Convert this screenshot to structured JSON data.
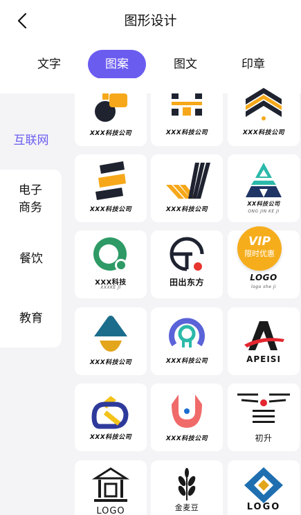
{
  "header": {
    "title": "图形设计"
  },
  "tabs": [
    {
      "label": "文字",
      "active": false
    },
    {
      "label": "图案",
      "active": true
    },
    {
      "label": "图文",
      "active": false
    },
    {
      "label": "印章",
      "active": false
    }
  ],
  "sidebar": {
    "items": [
      {
        "label": "互联网",
        "active": true
      },
      {
        "label": "电子商务",
        "active": false
      },
      {
        "label": "餐饮",
        "active": false
      },
      {
        "label": "教育",
        "active": false
      }
    ]
  },
  "logos": [
    {
      "caption": "XXX科技公司"
    },
    {
      "caption": "XXX科技公司"
    },
    {
      "caption": "XXX科技公司"
    },
    {
      "caption": "XXX科技公司"
    },
    {
      "caption": "XXX科技公司"
    },
    {
      "caption": "XX科技公司",
      "sub": "ONG JIN KE JI"
    },
    {
      "caption": "XXX科技",
      "sub": "XXXKE JI"
    },
    {
      "caption": "田出东方"
    },
    {
      "caption": "LOGO",
      "sub": "logo she ji"
    },
    {
      "caption": "XXX科技公司"
    },
    {
      "caption": "XXX科技公司"
    },
    {
      "caption": "APEISI"
    },
    {
      "caption": "XXX科技公司"
    },
    {
      "caption": "XXX科技公司"
    },
    {
      "caption": "初升"
    },
    {
      "caption": "LOGO"
    },
    {
      "caption": "金麦豆"
    },
    {
      "caption": "LOGO"
    }
  ],
  "vip_badge": {
    "title": "VIP",
    "subtitle": "限时优惠"
  },
  "colors": {
    "accent": "#6b5cf0",
    "page_bg": "#f4f4f6",
    "vip": "#f6ad1c"
  }
}
